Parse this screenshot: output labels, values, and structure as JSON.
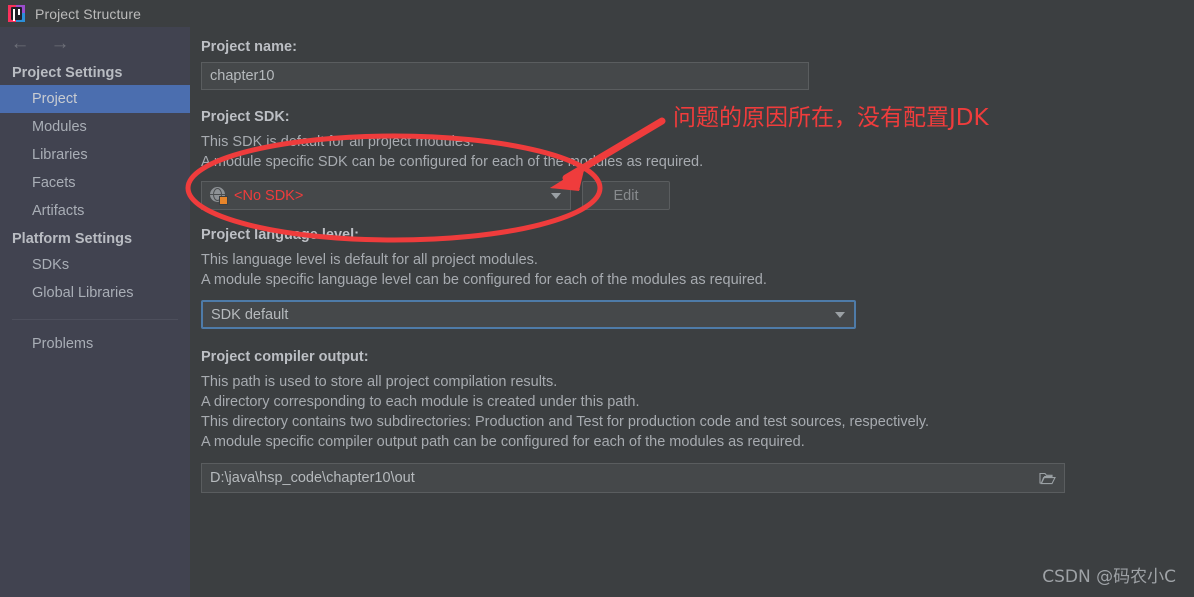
{
  "window": {
    "title": "Project Structure",
    "app_icon": "intellij-idea-icon"
  },
  "nav": {
    "back_icon": "arrow-left-icon",
    "forward_icon": "arrow-right-icon"
  },
  "sidebar": {
    "groups": [
      {
        "title": "Project Settings",
        "items": [
          {
            "label": "Project",
            "selected": true
          },
          {
            "label": "Modules",
            "selected": false
          },
          {
            "label": "Libraries",
            "selected": false
          },
          {
            "label": "Facets",
            "selected": false
          },
          {
            "label": "Artifacts",
            "selected": false
          }
        ]
      },
      {
        "title": "Platform Settings",
        "items": [
          {
            "label": "SDKs",
            "selected": false
          },
          {
            "label": "Global Libraries",
            "selected": false
          }
        ]
      }
    ],
    "problems_label": "Problems"
  },
  "main": {
    "project_name": {
      "label": "Project name:",
      "value": "chapter10"
    },
    "project_sdk": {
      "label": "Project SDK:",
      "desc_line1": "This SDK is default for all project modules.",
      "desc_line2": "A module specific SDK can be configured for each of the modules as required.",
      "selected": "<No SDK>",
      "selected_color": "#ef3c3c",
      "icon": "sdk-globe-icon",
      "edit_button": "Edit"
    },
    "language_level": {
      "label": "Project language level:",
      "desc_line1": "This language level is default for all project modules.",
      "desc_line2": "A module specific language level can be configured for each of the modules as required.",
      "selected": "SDK default"
    },
    "compiler_output": {
      "label": "Project compiler output:",
      "desc_line1": "This path is used to store all project compilation results.",
      "desc_line2": "A directory corresponding to each module is created under this path.",
      "desc_line3": "This directory contains two subdirectories: Production and Test for production code and test sources, respectively.",
      "desc_line4": "A module specific compiler output path can be configured for each of the modules as required.",
      "value": "D:\\java\\hsp_code\\chapter10\\out",
      "browse_icon": "folder-open-icon"
    }
  },
  "annotation": {
    "text": "问题的原因所在，没有配置JDK",
    "color": "#ef3c3c",
    "ellipse_label": "red-ellipse-highlight",
    "arrow_label": "red-arrow-pointer"
  },
  "watermark": {
    "text": "CSDN @码农小C"
  }
}
